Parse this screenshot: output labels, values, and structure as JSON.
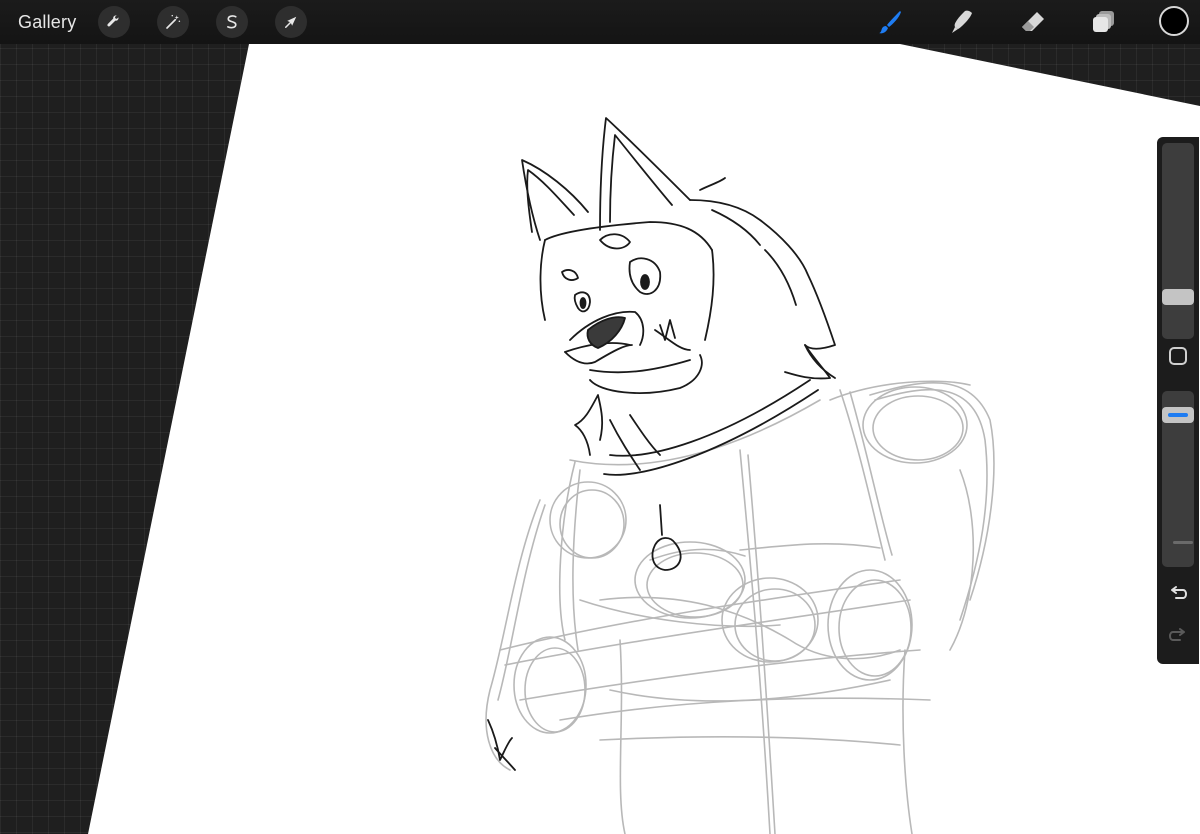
{
  "toolbar": {
    "gallery_label": "Gallery",
    "left_tools": [
      {
        "name": "actions",
        "icon": "wrench-icon"
      },
      {
        "name": "adjustments",
        "icon": "magic-wand-icon"
      },
      {
        "name": "selection",
        "icon": "selection-s-icon"
      },
      {
        "name": "transform",
        "icon": "transform-arrow-icon"
      }
    ],
    "right_tools": [
      {
        "name": "brush",
        "icon": "brush-icon",
        "active": true
      },
      {
        "name": "smudge",
        "icon": "smudge-icon",
        "active": false
      },
      {
        "name": "eraser",
        "icon": "eraser-icon",
        "active": false
      },
      {
        "name": "layers",
        "icon": "layers-icon",
        "active": false
      }
    ],
    "current_color": "#000000"
  },
  "sidebar": {
    "brush_size_level": 0.19,
    "opacity_level": 0.9
  },
  "colors": {
    "accent": "#1e7cf2",
    "toolbar_bg": "#161616",
    "workspace_bg": "#1f1f1f",
    "paper": "#ffffff",
    "sketch_line": "#1a1a1a",
    "construction_line": "#b5b5b5"
  }
}
